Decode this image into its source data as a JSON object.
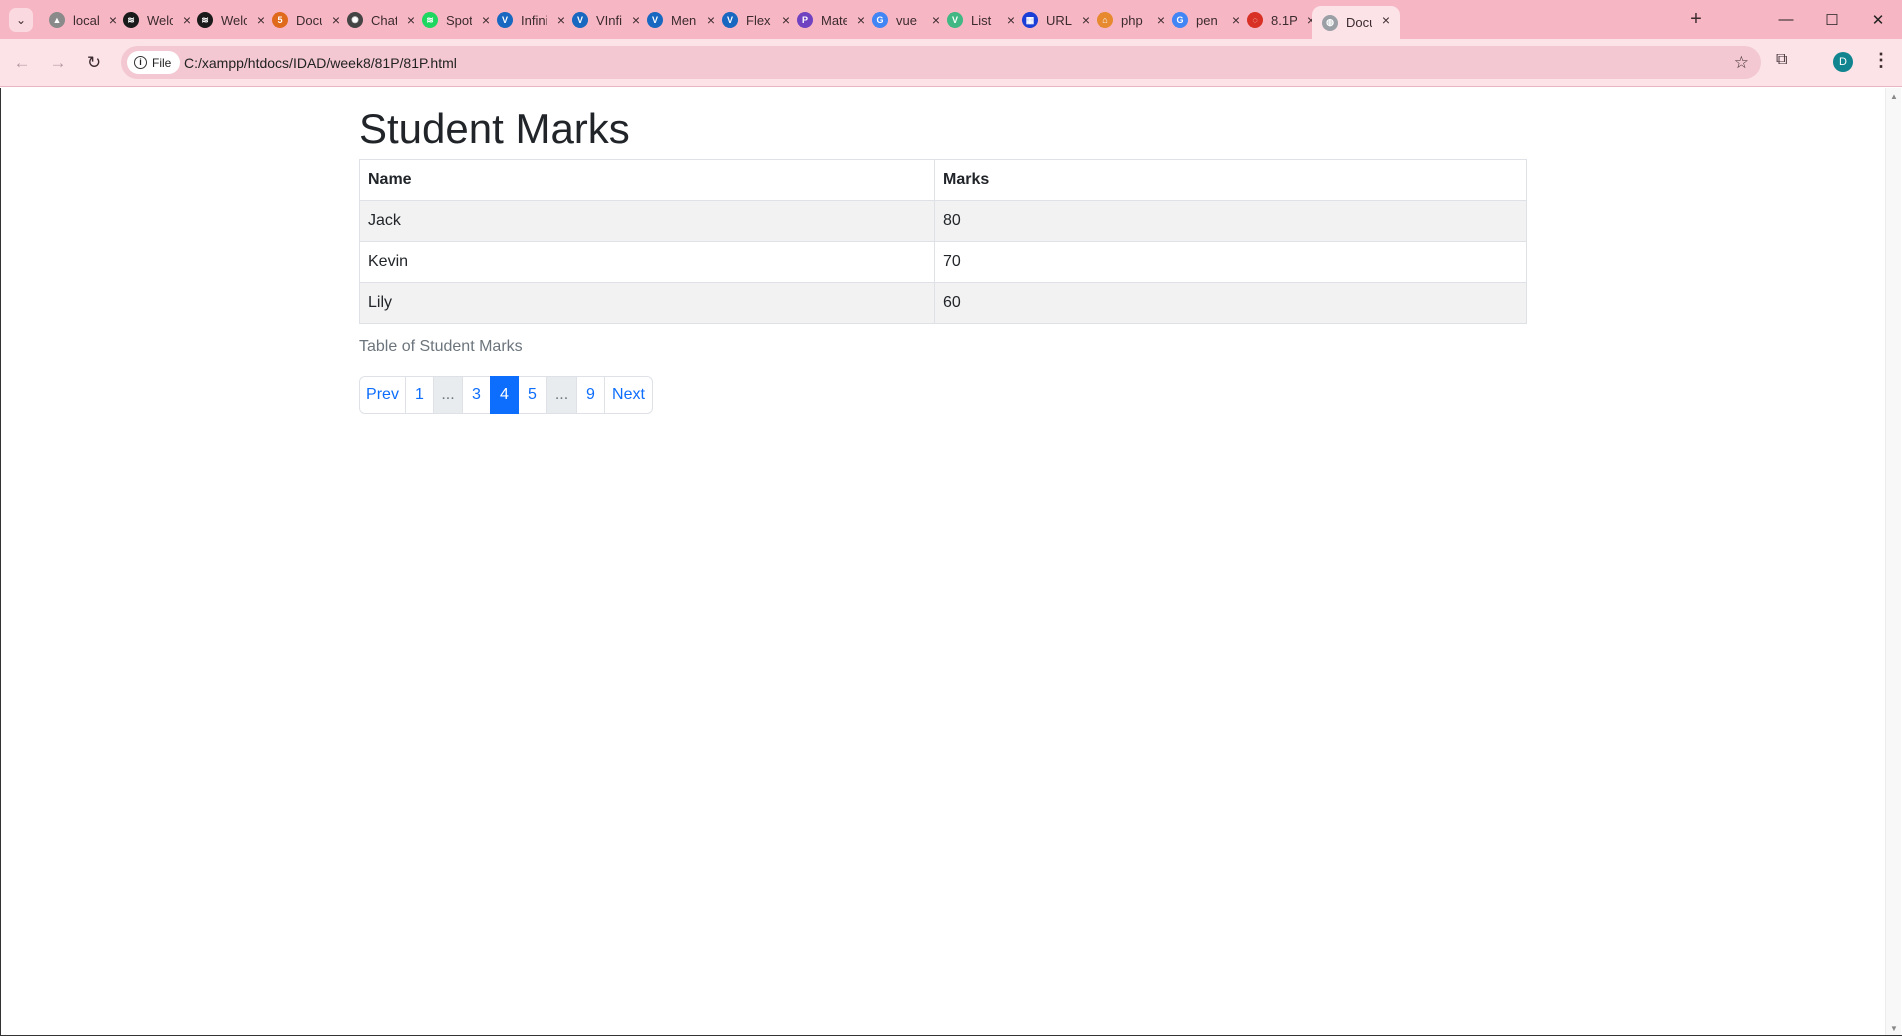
{
  "browser": {
    "tabs": [
      {
        "title": "localhost",
        "icon": "xampp-icon",
        "color": "#8a8a8a",
        "glyph": "▲"
      },
      {
        "title": "Welcome",
        "icon": "spotify-icon",
        "color": "#1a1a1a",
        "glyph": "≋"
      },
      {
        "title": "Welcome",
        "icon": "spotify-icon",
        "color": "#1a1a1a",
        "glyph": "≋"
      },
      {
        "title": "Document",
        "icon": "html-icon",
        "color": "#e06a1b",
        "glyph": "5"
      },
      {
        "title": "ChatGPT",
        "icon": "openai-icon",
        "color": "#444444",
        "glyph": "✺"
      },
      {
        "title": "Spotify",
        "icon": "spotify-icon",
        "color": "#1ed760",
        "glyph": "≋"
      },
      {
        "title": "Infinite",
        "icon": "vuetify-icon",
        "color": "#1867c0",
        "glyph": "V"
      },
      {
        "title": "VInfinite",
        "icon": "vuetify-icon",
        "color": "#1867c0",
        "glyph": "V"
      },
      {
        "title": "Menus",
        "icon": "vuetify-icon",
        "color": "#1867c0",
        "glyph": "V"
      },
      {
        "title": "Flex",
        "icon": "vuetify-icon",
        "color": "#1867c0",
        "glyph": "V"
      },
      {
        "title": "Material",
        "icon": "material-icon",
        "color": "#6f42c1",
        "glyph": "P"
      },
      {
        "title": "vue",
        "icon": "google-icon",
        "color": "#4285f4",
        "glyph": "G"
      },
      {
        "title": "List",
        "icon": "vue-icon",
        "color": "#41b883",
        "glyph": "V"
      },
      {
        "title": "URL",
        "icon": "w3schools-icon",
        "color": "#1a3ed6",
        "glyph": "▦"
      },
      {
        "title": "php",
        "icon": "php-icon",
        "color": "#e6892f",
        "glyph": "⌂"
      },
      {
        "title": "pen",
        "icon": "google-icon",
        "color": "#4285f4",
        "glyph": "G"
      },
      {
        "title": "8.1P",
        "icon": "loading-icon",
        "color": "#d93025",
        "glyph": "◌"
      },
      {
        "title": "Document",
        "icon": "globe-icon",
        "color": "#9aa0a6",
        "glyph": "◍",
        "active": true
      }
    ],
    "chip_label": "File",
    "url": "C:/xampp/htdocs/IDAD/week8/81P/81P.html",
    "profile_initial": "D"
  },
  "page": {
    "title": "Student Marks",
    "table": {
      "headers": [
        "Name",
        "Marks"
      ],
      "rows": [
        {
          "name": "Jack",
          "marks": "80"
        },
        {
          "name": "Kevin",
          "marks": "70"
        },
        {
          "name": "Lily",
          "marks": "60"
        }
      ]
    },
    "caption": "Table of Student Marks",
    "pagination": [
      {
        "label": "Prev",
        "state": "normal"
      },
      {
        "label": "1",
        "state": "normal"
      },
      {
        "label": "...",
        "state": "disabled"
      },
      {
        "label": "3",
        "state": "normal"
      },
      {
        "label": "4",
        "state": "active"
      },
      {
        "label": "5",
        "state": "normal"
      },
      {
        "label": "...",
        "state": "disabled"
      },
      {
        "label": "9",
        "state": "normal"
      },
      {
        "label": "Next",
        "state": "normal"
      }
    ]
  },
  "colors": {
    "tabstrip": "#f7b6c3",
    "toolbar": "#fce3e8",
    "primary": "#0d6efd",
    "striped_row": "#f2f2f2"
  }
}
